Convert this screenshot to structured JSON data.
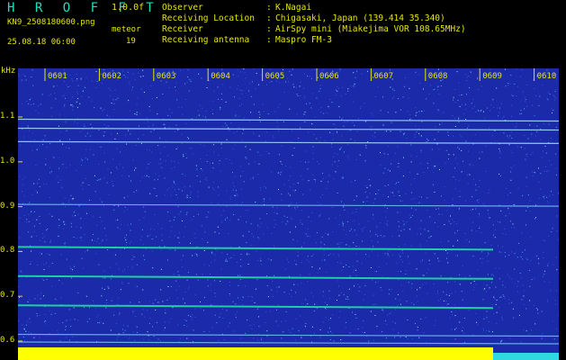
{
  "header": {
    "logo": "H R O F F T",
    "version": "1.0.0f",
    "filename": "KN9_2508180600.png",
    "datetime": "25.08.18 06:00",
    "meteor_label": "meteor",
    "meteor_count": "19",
    "fields": [
      {
        "label": "Observer",
        "value": "K.Nagai"
      },
      {
        "label": "Receiving Location",
        "value": "Chigasaki, Japan (139.414 35.340)"
      },
      {
        "label": "Receiver",
        "value": "AirSpy mini (Miakejima VOR 108.65MHz)"
      },
      {
        "label": "Receiving antenna",
        "value": "Maspro FM-3"
      }
    ],
    "colon": ":"
  },
  "colors": {
    "background": "#1a2aa8",
    "text": "#e6e600",
    "logo": "#18e0c0",
    "signal": "#20e0a0",
    "noise_floor": "#ffff00"
  },
  "chart_data": {
    "type": "heatmap",
    "ylabel": "kHz",
    "y_ticks": [
      "1.1",
      "1.0",
      "0.9",
      "0.8",
      "0.7",
      "0.6"
    ],
    "x_ticks": [
      "0601",
      "0602",
      "0603",
      "0604",
      "0605",
      "0606",
      "0607",
      "0608",
      "0609",
      "0610"
    ],
    "ylim": [
      0.58,
      1.16
    ],
    "carrier_lines_khz": [
      1.095,
      1.075,
      1.045,
      0.905,
      0.81,
      0.745,
      0.68,
      0.615,
      0.598
    ]
  }
}
